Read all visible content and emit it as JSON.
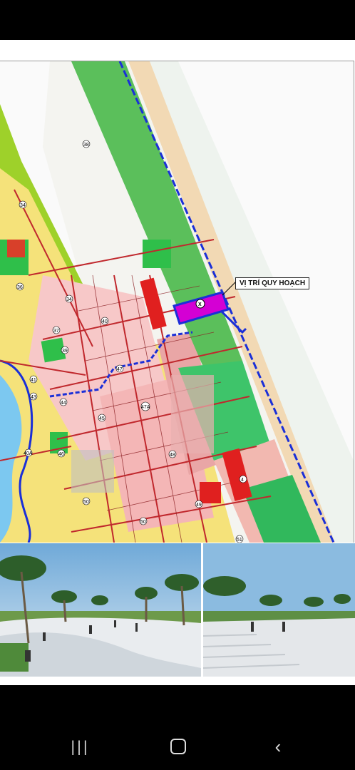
{
  "map": {
    "callout_text": "VỊ TRÍ QUY HOẠCH",
    "site_marker": "X",
    "area_labels": [
      "38",
      "34",
      "36",
      "34",
      "37",
      "40",
      "39",
      "47",
      "41",
      "43",
      "44",
      "45",
      "47A",
      "48",
      "46",
      "50",
      "49",
      "50",
      "51",
      "40A",
      "4"
    ]
  },
  "colors": {
    "coast_boundary": "#1a2fd8",
    "planned_site": "#d400d4",
    "roads": "#c0282d",
    "green_areas": "#22c84a",
    "sand": "#f2d9b4"
  },
  "icons": {
    "recent_apps": "recent-apps-icon",
    "home": "home-icon",
    "back": "back-icon"
  },
  "nav": {
    "recent_glyph": "|||",
    "back_glyph": "‹"
  }
}
